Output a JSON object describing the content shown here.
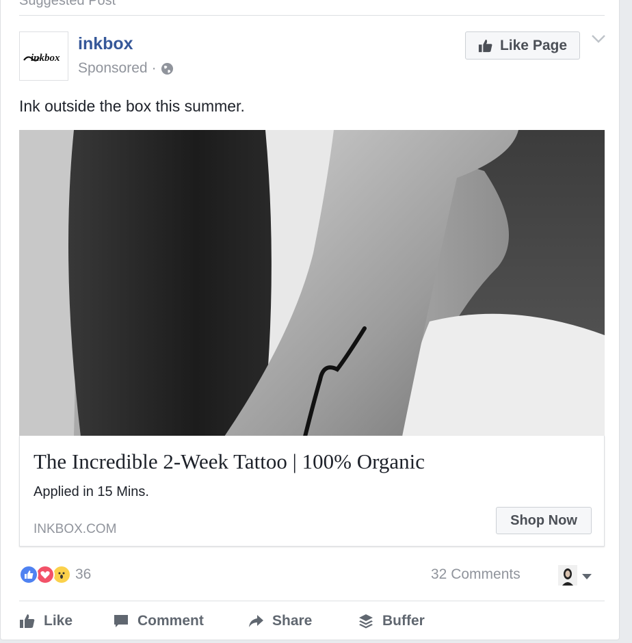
{
  "section_header": "Suggested Post",
  "post": {
    "page_name": "inkbox",
    "logo_text": "inkbox",
    "sponsored_label": "Sponsored",
    "separator": "·",
    "like_page_label": "Like Page",
    "caption": "Ink outside the box this summer."
  },
  "link": {
    "title": "The Incredible 2-Week Tattoo | 100% Organic",
    "description": "Applied in 15 Mins.",
    "domain": "INKBOX.COM",
    "cta_label": "Shop Now"
  },
  "engagement": {
    "reaction_count": "36",
    "comments_label": "32 Comments"
  },
  "actions": {
    "like": "Like",
    "comment": "Comment",
    "share": "Share",
    "buffer": "Buffer"
  },
  "colors": {
    "brand_blue": "#365899",
    "like_reaction": "#4f82f1",
    "love_reaction": "#f25268",
    "wow_reaction": "#fbd14b"
  },
  "icons": [
    "globe-icon",
    "thumbs-up-icon",
    "chevron-down-icon",
    "comment-icon",
    "share-arrow-icon",
    "buffer-stack-icon"
  ]
}
